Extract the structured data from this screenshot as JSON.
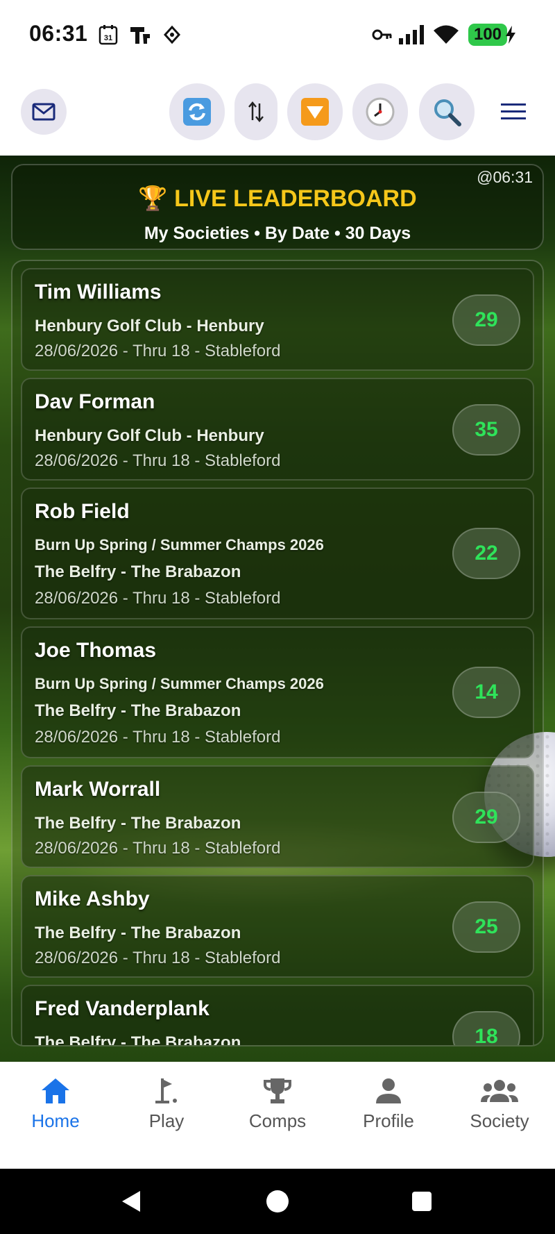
{
  "status_bar": {
    "time": "06:31",
    "calendar_text": "31",
    "battery_text": "100"
  },
  "toolbar": {
    "buttons": [
      "mail-icon",
      "refresh-icon",
      "sort-icon",
      "filter-icon",
      "clock-icon",
      "search-icon",
      "menu-icon"
    ]
  },
  "header": {
    "updated": "@06:31",
    "title": "🏆 LIVE LEADERBOARD",
    "subtitle": "My Societies • By Date • 30 Days"
  },
  "entries": [
    {
      "name": "Tim Williams",
      "event": "",
      "course": "Henbury Golf Club - Henbury",
      "detail": "28/06/2026 - Thru 18 - Stableford",
      "score": "29"
    },
    {
      "name": "Dav Forman",
      "event": "",
      "course": "Henbury Golf Club - Henbury",
      "detail": "28/06/2026 - Thru 18 - Stableford",
      "score": "35"
    },
    {
      "name": "Rob Field",
      "event": "Burn Up Spring / Summer Champs 2026",
      "course": "The Belfry - The Brabazon",
      "detail": "28/06/2026 - Thru 18 - Stableford",
      "score": "22"
    },
    {
      "name": "Joe Thomas",
      "event": "Burn Up Spring / Summer Champs 2026",
      "course": "The Belfry - The Brabazon",
      "detail": "28/06/2026 - Thru 18 - Stableford",
      "score": "14"
    },
    {
      "name": "Mark Worrall",
      "event": "",
      "course": "The Belfry - The Brabazon",
      "detail": "28/06/2026 - Thru 18 - Stableford",
      "score": "29"
    },
    {
      "name": "Mike Ashby",
      "event": "",
      "course": "The Belfry - The Brabazon",
      "detail": "28/06/2026 - Thru 18 - Stableford",
      "score": "25"
    },
    {
      "name": "Fred Vanderplank",
      "event": "",
      "course": "The Belfry - The Brabazon",
      "detail": "",
      "score": "18"
    }
  ],
  "nav": {
    "items": [
      {
        "label": "Home",
        "icon": "home-icon",
        "active": true
      },
      {
        "label": "Play",
        "icon": "golf-flag-icon",
        "active": false
      },
      {
        "label": "Comps",
        "icon": "trophy-icon",
        "active": false
      },
      {
        "label": "Profile",
        "icon": "person-icon",
        "active": false
      },
      {
        "label": "Society",
        "icon": "group-icon",
        "active": false
      }
    ]
  },
  "colors": {
    "accent": "#1a73e8",
    "title_gold": "#f5c71a",
    "score_green": "#2fe35a",
    "battery_green": "#2fc84a"
  }
}
